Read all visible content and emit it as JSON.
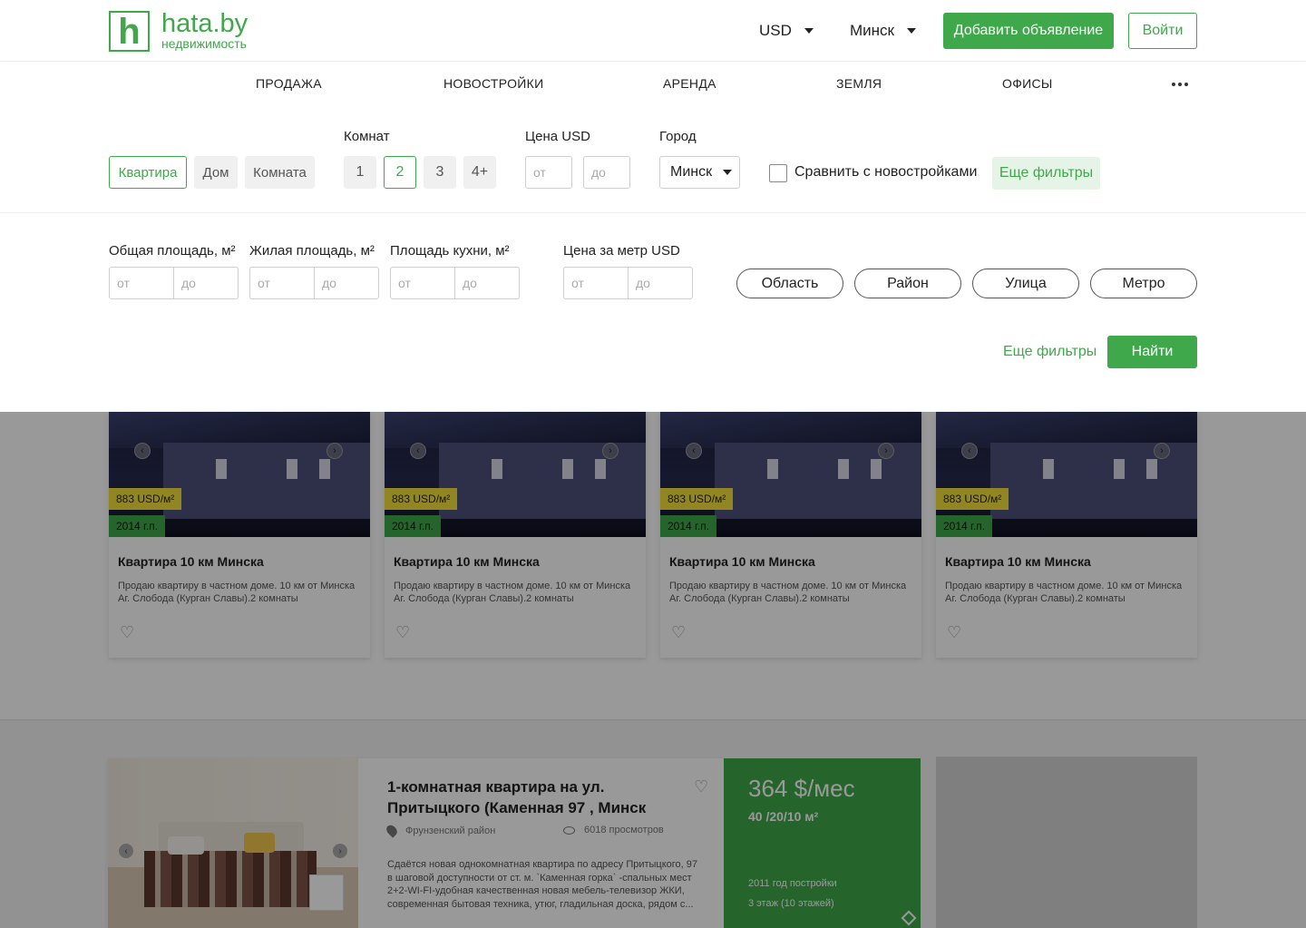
{
  "header": {
    "logo_letter": "h",
    "logo_name": "hata.by",
    "logo_sub": "недвижимость",
    "currency": "USD",
    "city": "Минск",
    "add_button": "Добавить объявление",
    "login_button": "Войти"
  },
  "nav": {
    "items": [
      "ПРОДАЖА",
      "НОВОСТРОЙКИ",
      "АРЕНДА",
      "ЗЕМЛЯ",
      "ОФИСЫ"
    ]
  },
  "filters": {
    "types": [
      "Квартира",
      "Дом",
      "Комната"
    ],
    "active_type": "Квартира",
    "rooms_label": "Комнат",
    "rooms": [
      "1",
      "2",
      "3",
      "4+"
    ],
    "active_room": "2",
    "price_label": "Цена USD",
    "price_from": "от",
    "price_to": "до",
    "city_label": "Город",
    "city_value": "Минск",
    "compare_label": "Сравнить с новостройками",
    "more_filters_top": "Еще фильтры",
    "total_area_label": "Общая площадь, м²",
    "living_area_label": "Жилая площадь, м²",
    "kitchen_area_label": "Площадь кухни, м²",
    "price_per_m_label": "Цена за метр USD",
    "from": "от",
    "to": "до",
    "pills": [
      "Область",
      "Район",
      "Улица",
      "Метро"
    ],
    "more_filters_link": "Еще фильтры",
    "find_button": "Найти"
  },
  "cards": [
    {
      "price_tag": "883 USD/м²",
      "year_tag": "2014 г.п.",
      "title": "Квартира 10 км Минска",
      "desc": "Продаю квартиру в частном доме. 10 км от Минска Аг. Слобода (Курган Славы).2 комнаты"
    },
    {
      "price_tag": "883 USD/м²",
      "year_tag": "2014 г.п.",
      "title": "Квартира 10 км Минска",
      "desc": "Продаю квартиру в частном доме. 10 км от Минска Аг. Слобода (Курган Славы).2 комнаты"
    },
    {
      "price_tag": "883 USD/м²",
      "year_tag": "2014 г.п.",
      "title": "Квартира 10 км Минска",
      "desc": "Продаю квартиру в частном доме. 10 км от Минска Аг. Слобода (Курган Славы).2 комнаты"
    },
    {
      "price_tag": "883 USD/м²",
      "year_tag": "2014 г.п.",
      "title": "Квартира 10 км Минска",
      "desc": "Продаю квартиру в частном доме. 10 км от Минска Аг. Слобода (Курган Славы).2 комнаты"
    }
  ],
  "featured": {
    "title": "1-комнатная квартира на ул. Притыцкого (Каменная 97 , Минск",
    "district": "Фрунзенский район",
    "views": "6018 просмотров",
    "desc": "Сдаётся новая однокомнатная квартира по адресу Притыцкого, 97 в шаговой доступности от ст. м. `Каменная горка` -спальных мест 2+2-WI-FI-удобная качественная новая мебель-телевизор ЖКИ, современная бытовая техника, утюг, гладильная доска, рядом с...",
    "price": "364 $/мес",
    "area": "40 /20/10 м²",
    "year": "2011 год постройки",
    "floor": "3 этаж (10 этажей)"
  },
  "colors": {
    "accent": "#3fa84a",
    "price_tag": "#f3e03b"
  }
}
